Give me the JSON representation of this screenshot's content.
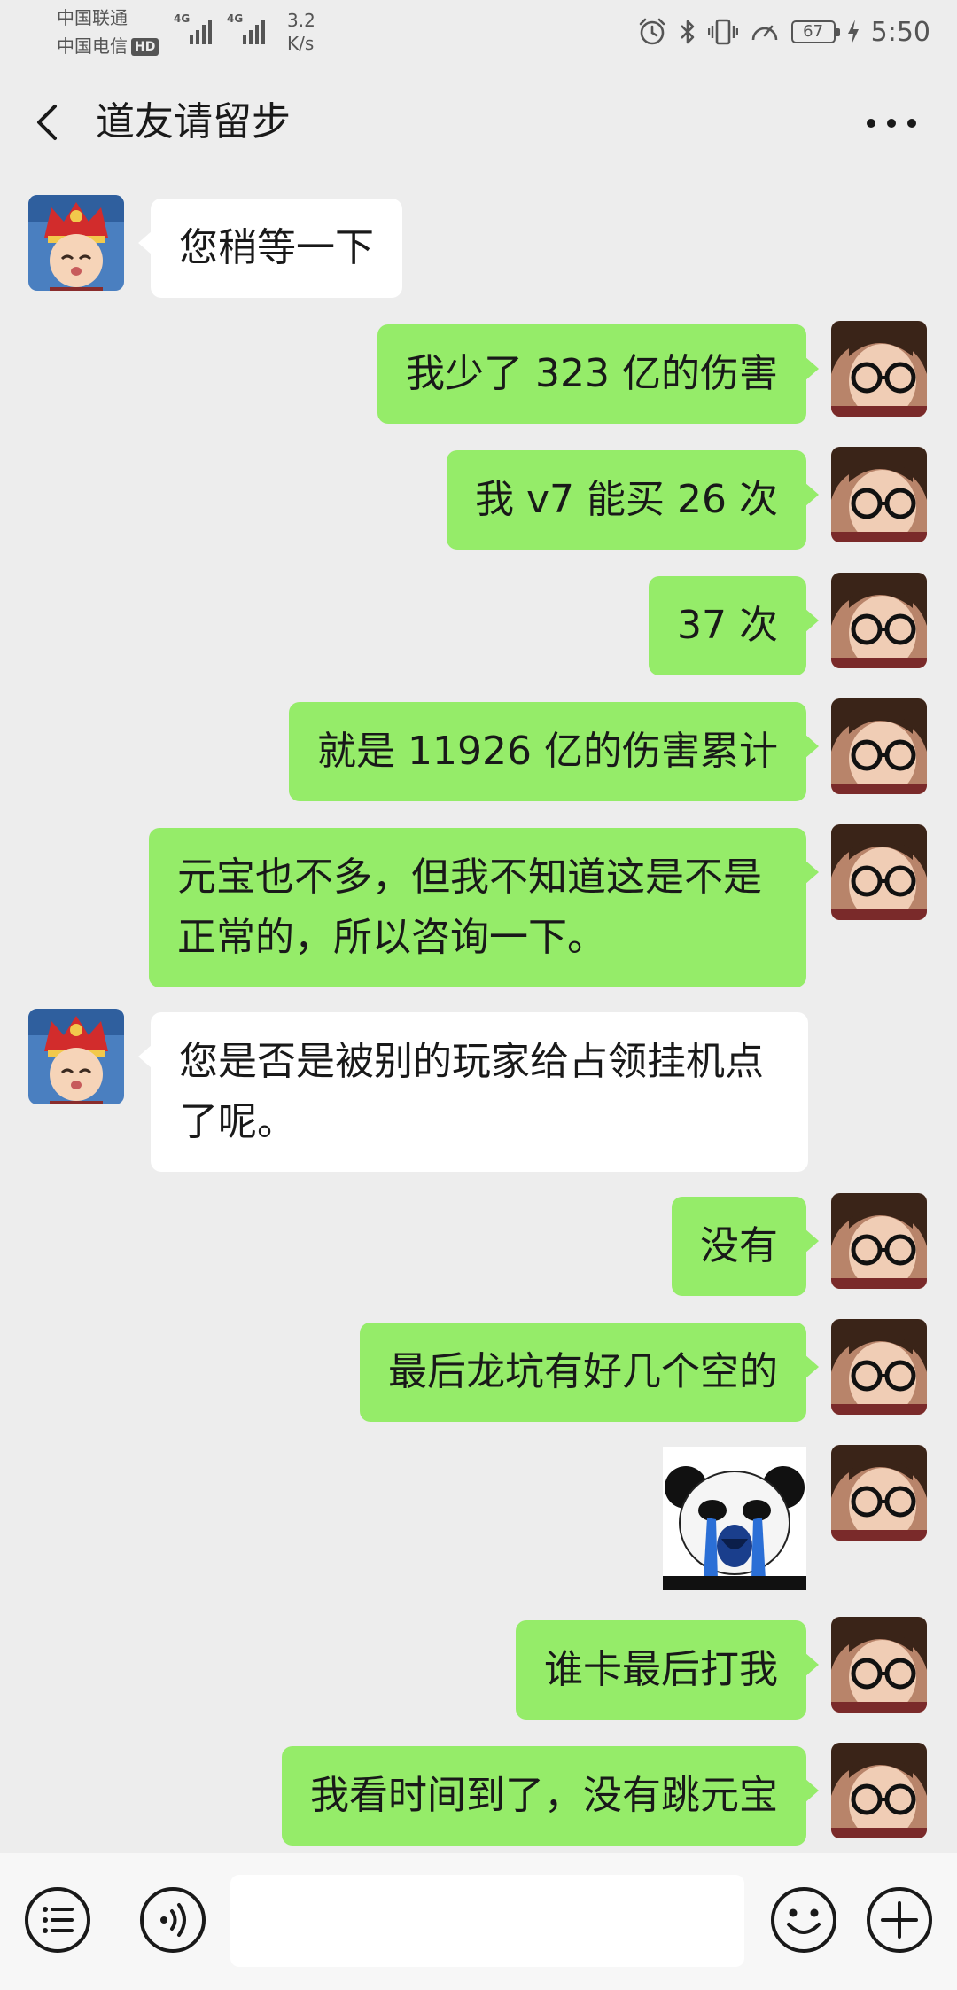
{
  "status_bar": {
    "carrier1": "中国联通",
    "carrier2": "中国电信",
    "hd_badge": "HD",
    "signal1_tag": "4G",
    "signal2_tag": "4G",
    "net_speed_value": "3.2",
    "net_speed_unit": "K/s",
    "battery_level": "67",
    "time": "5:50",
    "icons": [
      "alarm-icon",
      "bluetooth-icon",
      "vibrate-icon",
      "speed-icon",
      "battery-icon",
      "charging-icon"
    ]
  },
  "header": {
    "title": "道友请留步",
    "back_icon": "chevron-left-icon",
    "more_icon": "more-dots-icon"
  },
  "messages": [
    {
      "side": "in",
      "type": "text",
      "text": "您稍等一下"
    },
    {
      "side": "out",
      "type": "text",
      "text": "我少了 323 亿的伤害"
    },
    {
      "side": "out",
      "type": "text",
      "text": "我 v7 能买 26 次"
    },
    {
      "side": "out",
      "type": "text",
      "text": "37 次"
    },
    {
      "side": "out",
      "type": "text",
      "text": "就是 11926 亿的伤害累计"
    },
    {
      "side": "out",
      "type": "text",
      "text": "元宝也不多，但我不知道这是不是正常的，所以咨询一下。"
    },
    {
      "side": "in",
      "type": "text",
      "text": "您是否是被别的玩家给占领挂机点了呢。"
    },
    {
      "side": "out",
      "type": "text",
      "text": "没有"
    },
    {
      "side": "out",
      "type": "text",
      "text": "最后龙坑有好几个空的"
    },
    {
      "side": "out",
      "type": "sticker",
      "sticker": "crying-panda-sticker"
    },
    {
      "side": "out",
      "type": "text",
      "text": "谁卡最后打我"
    },
    {
      "side": "out",
      "type": "text",
      "text": "我看时间到了，没有跳元宝"
    }
  ],
  "input_bar": {
    "value": "",
    "menu_icon": "menu-list-icon",
    "voice_icon": "voice-icon",
    "emoji_icon": "emoji-icon",
    "plus_icon": "plus-icon"
  },
  "colors": {
    "background": "#ededed",
    "bubble_out": "#95ec69",
    "bubble_in": "#ffffff",
    "input_bar": "#f7f7f7"
  }
}
